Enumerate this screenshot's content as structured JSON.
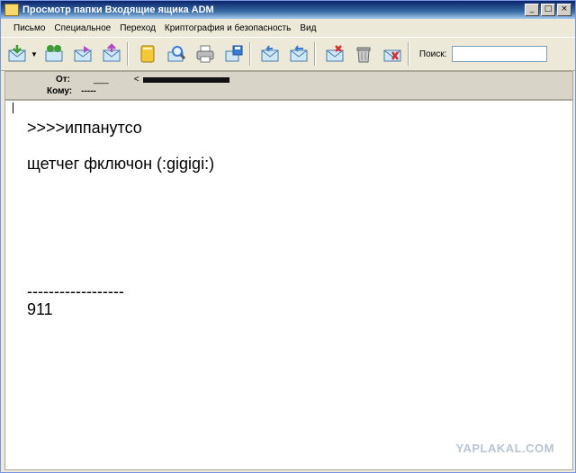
{
  "window": {
    "title": "Просмотр папки Входящие ящика ADM",
    "buttons": {
      "minimize": "_",
      "maximize": "□",
      "close": "×"
    }
  },
  "menu": [
    "Письмо",
    "Специальное",
    "Переход",
    "Криптография и безопасность",
    "Вид"
  ],
  "toolbar": {
    "buttons": [
      {
        "name": "receive-mail-icon",
        "color": "#3d9b35"
      },
      {
        "name": "receive-all-icon",
        "color": "#3d9b35"
      },
      {
        "name": "forward-mail-icon",
        "color": "#b04ac2"
      },
      {
        "name": "send-mail-icon",
        "color": "#b04ac2"
      },
      {
        "name": "address-book-icon",
        "color": "#e0b41a"
      },
      {
        "name": "find-icon",
        "color": "#3a7bd5"
      },
      {
        "name": "print-icon",
        "color": "#808080"
      },
      {
        "name": "save-icon",
        "color": "#3a7bd5"
      },
      {
        "name": "reply-icon",
        "color": "#3a7bd5"
      },
      {
        "name": "reply-all-icon",
        "color": "#3a7bd5"
      },
      {
        "name": "delete-mail-icon",
        "color": "#d03030"
      },
      {
        "name": "trash-icon",
        "color": "#808080"
      },
      {
        "name": "spam-icon",
        "color": "#d03030"
      }
    ],
    "search_label": "Поиск:",
    "search_value": ""
  },
  "header": {
    "from_label": "От:",
    "from_value": "___",
    "from_addr_prefix": "<",
    "to_label": "Кому:",
    "to_value": "-----"
  },
  "message": {
    "line1": ">>>>иппанутсо",
    "line2": "щетчег фключон (:gigigi:)",
    "divider": "------------------",
    "signature": "911"
  },
  "watermark": "YAPLAKAL.COM"
}
